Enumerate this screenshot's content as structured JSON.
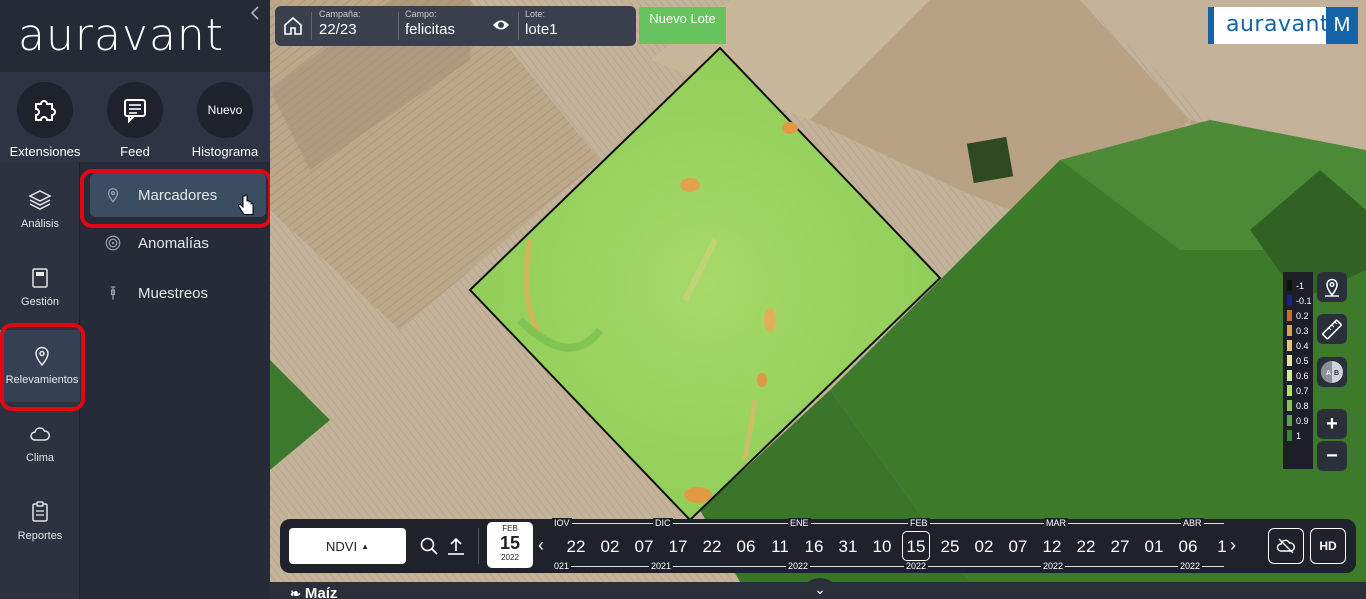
{
  "app": {
    "logo_text": "auravant",
    "brand_text": "auravant",
    "brand_user_initial": "M",
    "accent_color": "#2e9bd6",
    "brand_color": "#1563a8",
    "highlight_color": "#e30613"
  },
  "top_actions": [
    {
      "label": "Extensiones",
      "icon": "puzzle-icon"
    },
    {
      "label": "Feed",
      "icon": "message-icon"
    },
    {
      "label": "Histograma",
      "badge": "Nuevo"
    }
  ],
  "rail": [
    {
      "label": "Análisis",
      "icon": "layers-icon"
    },
    {
      "label": "Gestión",
      "icon": "calculator-icon"
    },
    {
      "label": "Relevamientos",
      "icon": "location-pin-icon",
      "active": true
    },
    {
      "label": "Clima",
      "icon": "cloud-icon"
    },
    {
      "label": "Reportes",
      "icon": "clipboard-icon"
    }
  ],
  "submenu": [
    {
      "label": "Marcadores",
      "icon": "pin-icon",
      "selected": true
    },
    {
      "label": "Anomalías",
      "icon": "target-icon"
    },
    {
      "label": "Muestreos",
      "icon": "probe-icon"
    }
  ],
  "fieldbar": {
    "campaign_caption": "Campaña:",
    "campaign_value": "22/23",
    "field_caption": "Campo:",
    "field_value": "felicitas",
    "lot_caption": "Lote:",
    "lot_value": "lote1",
    "new_lot_label": "Nuevo Lote"
  },
  "legend": {
    "values": [
      "-1",
      "-0.1",
      "0.2",
      "0.3",
      "0.4",
      "0.5",
      "0.6",
      "0.7",
      "0.8",
      "0.9",
      "1"
    ],
    "colors": [
      "#111111",
      "#1b1f9e",
      "#d2692a",
      "#e3a14b",
      "#e9c46a",
      "#eee39a",
      "#d7ea8e",
      "#b6dc6e",
      "#86c454",
      "#55a93e",
      "#2f8a2e"
    ]
  },
  "map_tools": {
    "zoom_in": "+",
    "zoom_out": "−"
  },
  "timeline": {
    "layer_label": "NDVI",
    "current": {
      "month": "FEB",
      "day": "15",
      "year": "2022"
    },
    "days": [
      "22",
      "02",
      "07",
      "17",
      "22",
      "06",
      "11",
      "16",
      "31",
      "10",
      "15",
      "25",
      "02",
      "07",
      "12",
      "22",
      "27",
      "01",
      "06",
      "1"
    ],
    "selected_index": 10,
    "months": [
      "IOV",
      "DIC",
      "ENE",
      "FEB",
      "MAR",
      "ABR"
    ],
    "years": [
      "021",
      "2021",
      "2022",
      "2022",
      "2022",
      "2022"
    ],
    "hd_label": "HD"
  },
  "crop": {
    "label": "Maíz"
  }
}
